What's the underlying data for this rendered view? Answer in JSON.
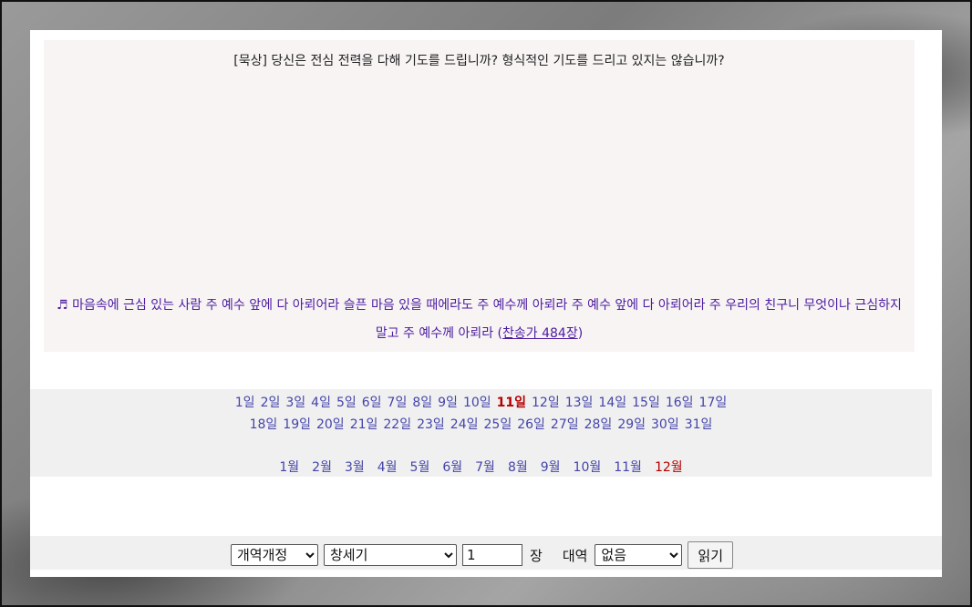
{
  "meditation": {
    "title": "[묵상] 당신은 전심 전력을 다해 기도를 드립니까? 형식적인 기도를 드리고 있지는 않습니까?",
    "hymn_icon": "♬",
    "hymn_text": "마음속에 근심 있는 사람 주 예수 앞에 다 아뢰어라 슬픈 마음 있을 때에라도 주 예수께 아뢰라 주 예수 앞에 다 아뢰어라 주 우리의 친구니 무엇이나 근심하지 말고 주 예수께 아뢰라",
    "hymn_link": "찬송가 484장"
  },
  "calendar": {
    "days_row1": [
      "1일",
      "2일",
      "3일",
      "4일",
      "5일",
      "6일",
      "7일",
      "8일",
      "9일",
      "10일",
      "11일",
      "12일",
      "13일",
      "14일",
      "15일",
      "16일",
      "17일"
    ],
    "days_row2": [
      "18일",
      "19일",
      "20일",
      "21일",
      "22일",
      "23일",
      "24일",
      "25일",
      "26일",
      "27일",
      "28일",
      "29일",
      "30일",
      "31일"
    ],
    "current_day": "11일",
    "months": [
      "1월",
      "2월",
      "3월",
      "4월",
      "5월",
      "6월",
      "7월",
      "8월",
      "9월",
      "10월",
      "11월",
      "12월"
    ],
    "current_month": "12월",
    "link_color": "#4444aa",
    "highlight_color": "#b30000"
  },
  "reader": {
    "version_selected": "개역개정",
    "book_selected": "창세기",
    "chapter_value": "1",
    "chapter_label": "장",
    "parallel_label": "대역",
    "parallel_selected": "없음",
    "read_button": "읽기"
  }
}
